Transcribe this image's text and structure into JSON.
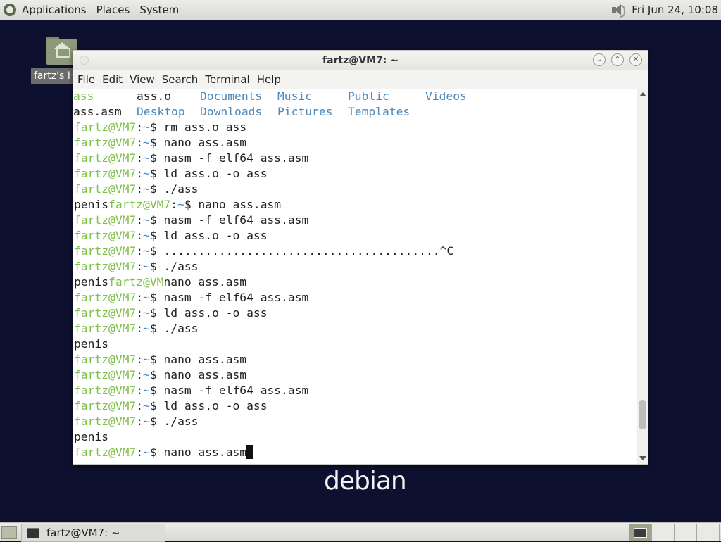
{
  "top_panel": {
    "menus": [
      "Applications",
      "Places",
      "System"
    ],
    "clock": "Fri Jun 24, 10:08"
  },
  "desktop": {
    "home_icon_label": "fartz's Home",
    "logo_text": "debian"
  },
  "terminal_window": {
    "title": "fartz@VM7: ~",
    "menubar": [
      "File",
      "Edit",
      "View",
      "Search",
      "Terminal",
      "Help"
    ],
    "ls_output": [
      [
        {
          "t": "ass",
          "c": "green"
        },
        {
          "t": "ass.o",
          "c": "plain"
        },
        {
          "t": "Documents",
          "c": "blue"
        },
        {
          "t": "Music",
          "c": "blue"
        },
        {
          "t": "Public",
          "c": "blue"
        },
        {
          "t": "Videos",
          "c": "blue"
        }
      ],
      [
        {
          "t": "ass.asm",
          "c": "plain"
        },
        {
          "t": "Desktop",
          "c": "blue"
        },
        {
          "t": "Downloads",
          "c": "blue"
        },
        {
          "t": "Pictures",
          "c": "blue"
        },
        {
          "t": "Templates",
          "c": "blue"
        }
      ]
    ],
    "prompt_user": "fartz@VM7",
    "prompt_path": "~",
    "lines": [
      {
        "pre": "",
        "prompt": true,
        "cmd": "rm ass.o ass"
      },
      {
        "pre": "",
        "prompt": true,
        "cmd": "nano ass.asm"
      },
      {
        "pre": "",
        "prompt": true,
        "cmd": "nasm -f elf64 ass.asm"
      },
      {
        "pre": "",
        "prompt": true,
        "cmd": "ld ass.o -o ass"
      },
      {
        "pre": "",
        "prompt": true,
        "cmd": "./ass"
      },
      {
        "pre": "penis",
        "prompt": true,
        "cmd": "nano ass.asm"
      },
      {
        "pre": "",
        "prompt": true,
        "cmd": "nasm -f elf64 ass.asm"
      },
      {
        "pre": "",
        "prompt": true,
        "cmd": "ld ass.o -o ass"
      },
      {
        "pre": "",
        "prompt": true,
        "cmd": "........................................^C"
      },
      {
        "pre": "",
        "prompt": true,
        "cmd": "./ass"
      },
      {
        "pre": "penis",
        "partial": "fartz@VM",
        "cmd": "nano ass.asm"
      },
      {
        "pre": "",
        "prompt": true,
        "cmd": "nasm -f elf64 ass.asm"
      },
      {
        "pre": "",
        "prompt": true,
        "cmd": "ld ass.o -o ass"
      },
      {
        "pre": "",
        "prompt": true,
        "cmd": "./ass"
      },
      {
        "pre": "penis",
        "prompt": false,
        "cmd": ""
      },
      {
        "pre": "",
        "prompt": true,
        "cmd": "nano ass.asm"
      },
      {
        "pre": "",
        "prompt": true,
        "cmd": "nano ass.asm"
      },
      {
        "pre": "",
        "prompt": true,
        "cmd": "nasm -f elf64 ass.asm"
      },
      {
        "pre": "",
        "prompt": true,
        "cmd": "ld ass.o -o ass"
      },
      {
        "pre": "",
        "prompt": true,
        "cmd": "./ass"
      },
      {
        "pre": "penis",
        "prompt": false,
        "cmd": ""
      },
      {
        "pre": "",
        "prompt": true,
        "cmd": "nano ass.asm",
        "cursor": true
      }
    ],
    "scroll_position": 0.92
  },
  "bottom_panel": {
    "task_label": "fartz@VM7: ~",
    "workspace_count": 4,
    "active_workspace": 1
  },
  "colors": {
    "prompt_green": "#7dc148",
    "dir_blue": "#4b88bb",
    "desktop_bg": "#0e1030"
  }
}
